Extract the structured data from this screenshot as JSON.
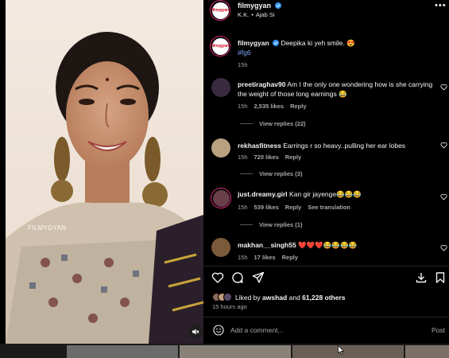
{
  "post": {
    "watermark": "FILMYGYAN",
    "account": {
      "username": "filmygyan",
      "logo_text": "filmygyan",
      "audio_artist": "K.K.",
      "audio_separator": "•",
      "audio_track": "Ajab Si"
    },
    "more_label": "•••",
    "caption": {
      "username": "filmygyan",
      "text": "Deepika ki yeh smile. 😍",
      "hashtag": "#fg6",
      "time": "15h"
    }
  },
  "comments": [
    {
      "username": "preetiraghav90",
      "text": "Am I the only one wondering how is she carrying the weight of those long earnings 😂",
      "time": "15h",
      "likes": "2,535 likes",
      "reply_label": "Reply",
      "view_replies": "View replies (22)"
    },
    {
      "username": "rekhasfitness",
      "text": "Earrings r so heavy..pulling her ear lobes",
      "time": "15h",
      "likes": "720 likes",
      "reply_label": "Reply",
      "view_replies": "View replies (3)"
    },
    {
      "username": "just.dreamy.girl",
      "text": "Kan gir jayenge😂😂😂",
      "time": "15h",
      "likes": "539 likes",
      "reply_label": "Reply",
      "translation_label": "See translation",
      "view_replies": "View replies (1)"
    },
    {
      "username": "makhan__singh55",
      "text": "❤️❤️❤️😂😂😂😂",
      "time": "15h",
      "likes": "17 likes",
      "reply_label": "Reply"
    }
  ],
  "engagement": {
    "liked_by_prefix": "Liked by",
    "liked_by_user": "awshad",
    "liked_by_and": "and",
    "others": "61,228 others",
    "posted_ago": "15 hours ago"
  },
  "comment_box": {
    "placeholder": "Add a comment...",
    "post_label": "Post"
  },
  "icons": {
    "like": "heart-icon",
    "comment": "comment-bubble-icon",
    "share": "paper-plane-icon",
    "download": "download-icon",
    "save": "bookmark-icon",
    "emoji": "emoji-icon",
    "mute": "muted-speaker-icon",
    "verified": "verified-badge-icon",
    "more": "more-options-icon"
  },
  "colors": {
    "background": "#000000",
    "text": "#f5f5f5",
    "secondary_text": "#a8a8a8",
    "link": "#7aa6ff",
    "verified": "#3897f0",
    "story_ring": "#d62976"
  }
}
